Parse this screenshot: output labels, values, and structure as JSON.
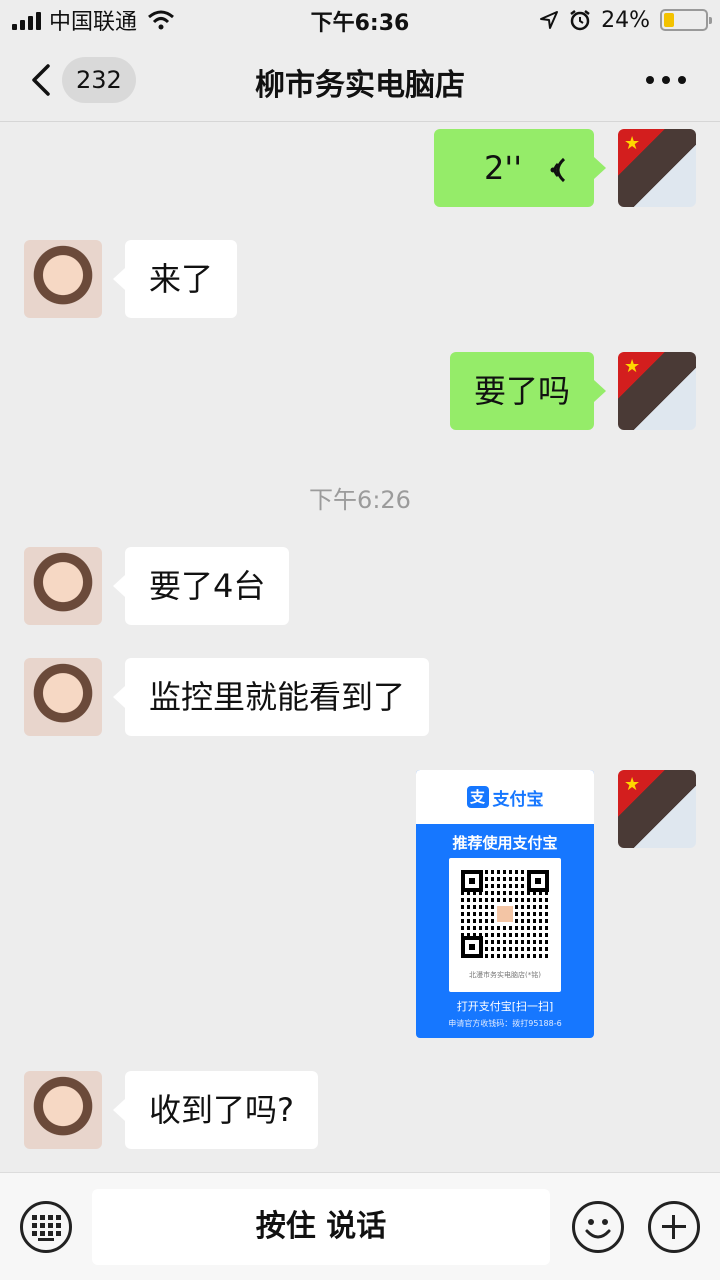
{
  "status_bar": {
    "carrier": "中国联通",
    "time": "下午6:36",
    "battery": "24%",
    "battery_level": 0.24,
    "icons": [
      "signal-icon",
      "wifi-icon",
      "location-icon",
      "alarm-icon",
      "battery-icon"
    ]
  },
  "nav": {
    "unread_count": "232",
    "title": "柳市务实电脑店"
  },
  "messages": {
    "voice_duration": "2''",
    "m1": "来了",
    "m2": "要了吗",
    "timestamp": "下午6:26",
    "m3": "要了4台",
    "m4": "监控里就能看到了",
    "m5": "收到了吗?"
  },
  "qr_card": {
    "brand": "支付宝",
    "title": "推荐使用支付宝",
    "small_text": "北漫市务实电脑店(*铭)",
    "open_text": "打开支付宝[扫一扫]",
    "footer": "申请官方收钱码：拨打95188-6"
  },
  "input_bar": {
    "talk_label": "按住 说话"
  },
  "colors": {
    "outgoing_bubble": "#95ec69",
    "incoming_bubble": "#ffffff",
    "background": "#ededed",
    "alipay_blue": "#1677ff"
  }
}
